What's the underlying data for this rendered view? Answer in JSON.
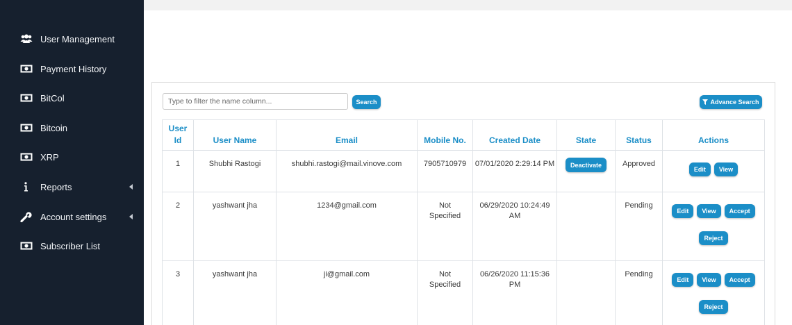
{
  "sidebar": {
    "items": [
      {
        "label": "User Management",
        "icon": "users-icon"
      },
      {
        "label": "Payment History",
        "icon": "money-icon"
      },
      {
        "label": "BitCol",
        "icon": "money-icon"
      },
      {
        "label": "Bitcoin",
        "icon": "money-icon"
      },
      {
        "label": "XRP",
        "icon": "money-icon"
      },
      {
        "label": "Reports",
        "icon": "info-icon",
        "has_submenu": true
      },
      {
        "label": "Account settings",
        "icon": "wrench-icon",
        "has_submenu": true
      },
      {
        "label": "Subscriber List",
        "icon": "money-icon"
      }
    ]
  },
  "toolbar": {
    "filter_placeholder": "Type to filter the name column...",
    "search_label": "Search",
    "advance_search_label": "Advance Search"
  },
  "table": {
    "headers": [
      "User Id",
      "User Name",
      "Email",
      "Mobile No.",
      "Created Date",
      "State",
      "Status",
      "Actions"
    ],
    "rows": [
      {
        "id": "1",
        "name": "Shubhi Rastogi",
        "email": "shubhi.rastogi@mail.vinove.com",
        "mobile": "7905710979",
        "created": "07/01/2020 2:29:14 PM",
        "state": "Deactivate",
        "status": "Approved",
        "actions": [
          "Edit",
          "View"
        ]
      },
      {
        "id": "2",
        "name": "yashwant jha",
        "email": "1234@gmail.com",
        "mobile": "Not Specified",
        "created": "06/29/2020 10:24:49 AM",
        "state": "",
        "status": "Pending",
        "actions": [
          "Edit",
          "View",
          "Accept",
          "Reject"
        ]
      },
      {
        "id": "3",
        "name": "yashwant jha",
        "email": "ji@gmail.com",
        "mobile": "Not Specified",
        "created": "06/26/2020 11:15:36 PM",
        "state": "",
        "status": "Pending",
        "actions": [
          "Edit",
          "View",
          "Accept",
          "Reject"
        ]
      }
    ]
  },
  "colors": {
    "sidebar_bg": "#16202e",
    "accent": "#1b8ec7",
    "approved": "#28a745",
    "pending": "#dc3545"
  }
}
